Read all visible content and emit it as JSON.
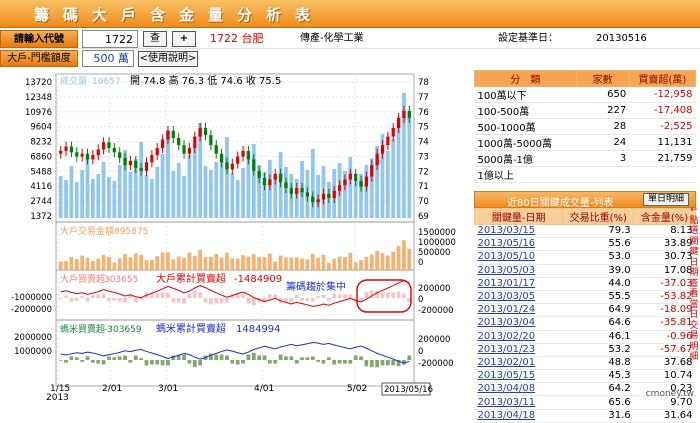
{
  "title": "籌碼大戶含金量分析表",
  "toolbar": {
    "input_label": "請輸入代號",
    "stock_code": "1722",
    "search_label": "查",
    "add_label": "+",
    "stock_display": "1722 台肥",
    "industry": "傳產-化學工業",
    "base_date_label": "設定基準日：",
    "base_date": "20130516"
  },
  "threshold": {
    "label": "大戶-門檻額度",
    "value": "500 萬",
    "help_label": "<使用說明>"
  },
  "chart": {
    "price_label": "成交量",
    "price_value": "10657",
    "ohlc": "開 74.8  高 76.3  低 74.6  收 75.5",
    "left_ticks": [
      "13720",
      "12348",
      "10976",
      "9604",
      "8232",
      "6860",
      "5488",
      "4116",
      "2744",
      "1372"
    ],
    "right_ticks": [
      "78",
      "77",
      "76",
      "75",
      "74",
      "73",
      "72",
      "71",
      "70",
      "69"
    ],
    "amount_label": "大戶交易金額",
    "amount_value": "895875",
    "amount_ticks": [
      "1500000",
      "1000000",
      "500000",
      "0"
    ],
    "big_label": "大戶買賣超",
    "big_value": "303655",
    "big_cum_label": "大戶累計買賣超",
    "big_cum_value": "-1484909",
    "big_left_ticks": [
      "-1000000",
      "-2000000"
    ],
    "big_right_ticks": [
      "200000",
      "0",
      "-200000"
    ],
    "annotation": "籌碼趨於集中",
    "small_label": "螞米買賣超",
    "small_value": "-303659",
    "small_cum_label": "螞米累計買賣超",
    "small_cum_value": "1484994",
    "small_left_ticks": [
      "2000000",
      "1000000"
    ],
    "small_right_ticks": [
      "200000",
      "0",
      "-200000"
    ],
    "x_labels": [
      "1/15",
      "2/01",
      "3/01",
      "4/01",
      "5/02"
    ],
    "x_year": "2013",
    "x_end": "2013/05/16"
  },
  "chart_data": {
    "type": "table",
    "price_close": [
      73.2,
      73.5,
      73.1,
      72.8,
      73.0,
      72.6,
      72.9,
      73.3,
      73.8,
      73.4,
      73.1,
      72.7,
      72.2,
      72.5,
      72.0,
      71.8,
      72.4,
      72.9,
      73.4,
      74.0,
      74.6,
      74.1,
      73.6,
      73.0,
      73.4,
      74.2,
      74.8,
      74.3,
      73.6,
      73.0,
      72.4,
      71.9,
      72.3,
      72.8,
      73.2,
      72.6,
      71.8,
      71.3,
      70.8,
      71.2,
      71.6,
      71.0,
      70.6,
      70.2,
      70.6,
      70.3,
      70.0,
      69.6,
      69.8,
      70.2,
      69.9,
      70.4,
      70.8,
      71.2,
      71.6,
      71.1,
      70.7,
      71.4,
      72.2,
      73.0,
      73.6,
      74.2,
      74.8,
      75.5,
      76.0,
      75.5
    ],
    "volume": [
      4200,
      3800,
      5200,
      3600,
      4800,
      6100,
      3900,
      4400,
      5600,
      4100,
      3700,
      5300,
      6800,
      4600,
      5900,
      7600,
      4300,
      3900,
      5100,
      6400,
      8800,
      4700,
      5500,
      4200,
      6300,
      7100,
      9500,
      5200,
      4800,
      5600,
      6200,
      8100,
      4500,
      3800,
      5000,
      6700,
      7400,
      5300,
      4600,
      5800,
      4200,
      6600,
      5100,
      4400,
      3900,
      5700,
      4800,
      6900,
      4300,
      5200,
      3600,
      4900,
      5500,
      4700,
      6100,
      3800,
      4400,
      5300,
      6000,
      7200,
      8400,
      6700,
      7900,
      10200,
      12500,
      10657
    ],
    "ranges": [
      {
        "range": "100萬以下",
        "count": 650,
        "net": -12958
      },
      {
        "range": "100-500萬",
        "count": 227,
        "net": -17408
      },
      {
        "range": "500-1000萬",
        "count": 28,
        "net": -2525
      },
      {
        "range": "1000萬-5000萬",
        "count": 24,
        "net": 11131
      },
      {
        "range": "5000萬-1億",
        "count": 3,
        "net": 21759
      },
      {
        "range": "1億以上",
        "count": null,
        "net": null
      }
    ]
  },
  "range_table": {
    "headers": [
      "分　類",
      "家數",
      "買賣超(萬)"
    ],
    "rows": [
      {
        "range": "100萬以下",
        "count": "650",
        "net": "-12,958",
        "neg": true
      },
      {
        "range": "100-500萬",
        "count": "227",
        "net": "-17,408",
        "neg": true
      },
      {
        "range": "500-1000萬",
        "count": "28",
        "net": "-2,525",
        "neg": true
      },
      {
        "range": "1000萬-5000萬",
        "count": "24",
        "net": "11,131",
        "neg": false
      },
      {
        "range": "5000萬-1億",
        "count": "3",
        "net": "21,759",
        "neg": false
      },
      {
        "range": "1億以上",
        "count": "",
        "net": "",
        "neg": false
      }
    ]
  },
  "key_table": {
    "title": "近80日關鍵成交量-列表",
    "btn_label": "單日明細",
    "headers": [
      "關鍵量-日期",
      "交易比重(%)",
      "含金量(%)"
    ],
    "rows": [
      {
        "date": "2013/03/15",
        "ratio": "79.3",
        "gold": "8.13",
        "neg": false
      },
      {
        "date": "2013/05/16",
        "ratio": "55.6",
        "gold": "33.89",
        "neg": false
      },
      {
        "date": "2013/05/10",
        "ratio": "53.0",
        "gold": "30.73",
        "neg": false
      },
      {
        "date": "2013/05/03",
        "ratio": "39.0",
        "gold": "17.08",
        "neg": false
      },
      {
        "date": "2013/01/17",
        "ratio": "44.0",
        "gold": "-37.03",
        "neg": true
      },
      {
        "date": "2013/03/05",
        "ratio": "55.5",
        "gold": "-53.82",
        "neg": true
      },
      {
        "date": "2013/01/24",
        "ratio": "64.9",
        "gold": "-18.09",
        "neg": true
      },
      {
        "date": "2013/03/04",
        "ratio": "64.6",
        "gold": "-35.81",
        "neg": true
      },
      {
        "date": "2013/02/20",
        "ratio": "46.1",
        "gold": "-0.96",
        "neg": true
      },
      {
        "date": "2013/01/23",
        "ratio": "53.2",
        "gold": "-57.67",
        "neg": true
      },
      {
        "date": "2013/02/01",
        "ratio": "48.8",
        "gold": "37.68",
        "neg": false
      },
      {
        "date": "2013/05/15",
        "ratio": "45.3",
        "gold": "10.74",
        "neg": false
      },
      {
        "date": "2013/04/08",
        "ord": "",
        "ratio": "64.2",
        "gold": "0.23",
        "neg": false
      },
      {
        "date": "2013/03/11",
        "ratio": "65.6",
        "gold": "9.70",
        "neg": false
      },
      {
        "date": "2013/04/18",
        "ratio": "31.6",
        "gold": "31.64",
        "neg": false
      }
    ]
  },
  "side_note": "←點選關鍵日期查看當日交易明細",
  "brand": "cmoney.tw",
  "colors": {
    "accent": "#f08a1c",
    "up": "#e00000",
    "down": "#008000",
    "volume": "#8fc7f0",
    "amount": "#f6b070",
    "cum_big": "#e00000",
    "cum_small": "#1a2fd0"
  }
}
